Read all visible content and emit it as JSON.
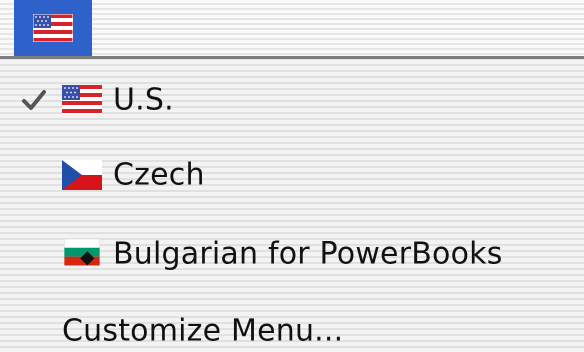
{
  "menubar": {
    "active_menu_icon": "us-flag-icon",
    "active_color": "#2e61c9"
  },
  "menu": {
    "items": [
      {
        "label": "U.S.",
        "icon": "us-flag-icon",
        "checked": true
      },
      {
        "label": "Czech",
        "icon": "czech-flag-icon",
        "checked": false
      },
      {
        "label": "Bulgarian for PowerBooks",
        "icon": "bulgarian-flag-icon",
        "checked": false
      },
      {
        "label": "Customize Menu...",
        "icon": null,
        "checked": false
      }
    ]
  }
}
